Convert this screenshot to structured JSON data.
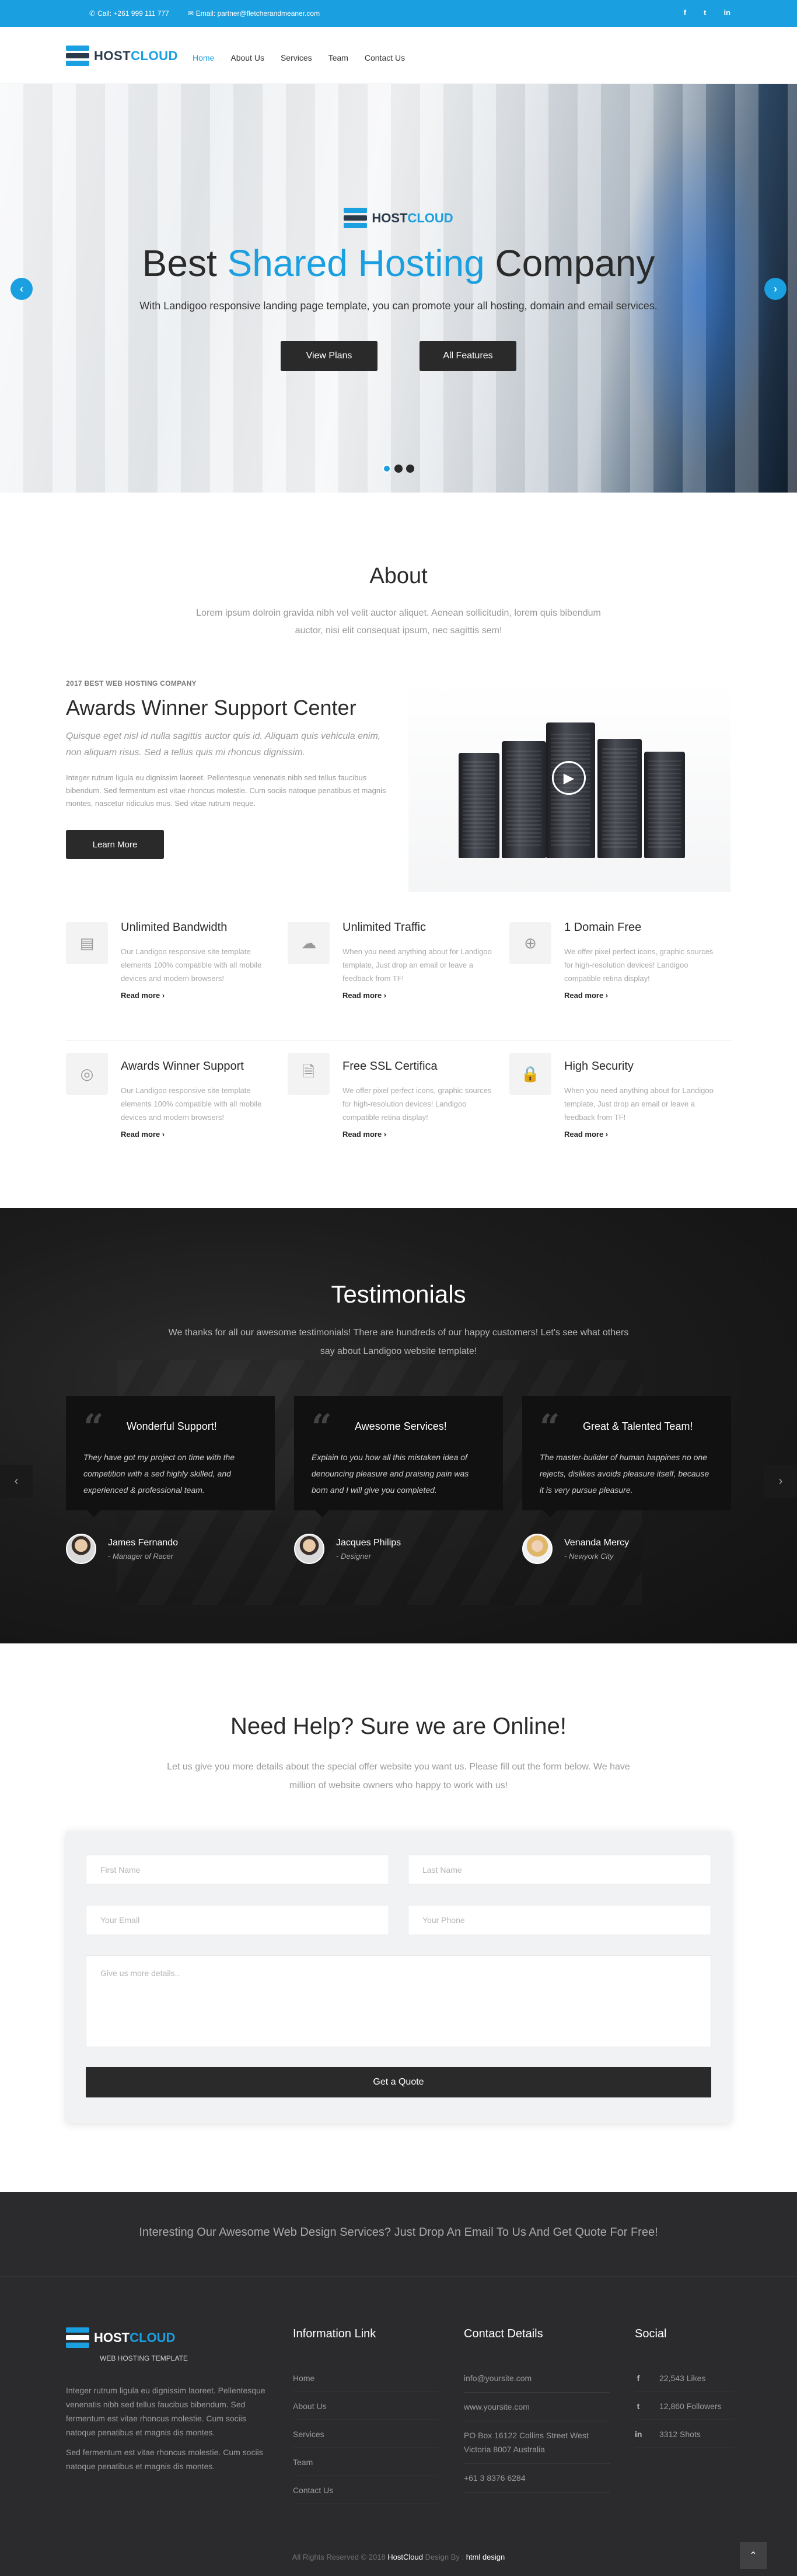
{
  "topbar": {
    "phone": "Call: +261 999 111 777",
    "email": "Email: partner@fletcherandmeaner.com",
    "social": [
      "f",
      "t",
      "in"
    ]
  },
  "brand": {
    "name_a": "HOST",
    "name_b": "CLOUD"
  },
  "nav": [
    "Home",
    "About Us",
    "Services",
    "Team",
    "Contact Us"
  ],
  "hero": {
    "title_a": "Best ",
    "title_hl": "Shared Hosting",
    "title_b": " Company",
    "subtitle": "With Landigoo responsive landing page template, you can promote your all hosting, domain and email services.",
    "btn_plans": "View Plans",
    "btn_features": "All Features",
    "prev": "‹",
    "next": "›"
  },
  "about": {
    "title": "About",
    "subtitle": "Lorem ipsum dolroin gravida nibh vel velit auctor aliquet. Aenean sollicitudin, lorem quis bibendum auctor, nisi elit consequat ipsum, nec sagittis sem!",
    "kicker": "2017 BEST WEB HOSTING COMPANY",
    "heading": "Awards Winner Support Center",
    "lead": "Quisque eget nisl id nulla sagittis auctor quis id. Aliquam quis vehicula enim, non aliquam risus. Sed a tellus quis mi rhoncus dignissim.",
    "body": "Integer rutrum ligula eu dignissim laoreet. Pellentesque venenatis nibh sed tellus faucibus bibendum. Sed fermentum est vitae rhoncus molestie. Cum sociis natoque penatibus et magnis montes, nascetur ridiculus mus. Sed vitae rutrum neque.",
    "btn": "Learn More"
  },
  "features": [
    {
      "icon": "film-icon",
      "glyph": "▤",
      "title": "Unlimited Bandwidth",
      "text": "Our Landigoo responsive site template elements 100% compatible with all mobile devices and modern browsers!",
      "link": "Read more ›"
    },
    {
      "icon": "cloud-icon",
      "glyph": "☁",
      "title": "Unlimited Traffic",
      "text": "When you need anything about for Landigoo template, Just drop an email or leave a feedback from TF!",
      "link": "Read more ›"
    },
    {
      "icon": "www-icon",
      "glyph": "⊕",
      "title": "1 Domain Free",
      "text": "We offer pixel perfect icons, graphic sources for high-resolution devices! Landigoo compatible retina display!",
      "link": "Read more ›"
    },
    {
      "icon": "wifi-icon",
      "glyph": "◎",
      "title": "Awards Winner Support",
      "text": "Our Landigoo responsive site template elements 100% compatible with all mobile devices and modern browsers!",
      "link": "Read more ›"
    },
    {
      "icon": "ssl-file-icon",
      "glyph": "🗎",
      "title": "Free SSL Certifica",
      "text": "We offer pixel perfect icons, graphic sources for high-resolution devices! Landigoo compatible retina display!",
      "link": "Read more ›"
    },
    {
      "icon": "lock-icon",
      "glyph": "🔒",
      "title": "High Security",
      "text": "When you need anything about for Landigoo template, Just drop an email or leave a feedback from TF!",
      "link": "Read more ›"
    }
  ],
  "testimonials": {
    "title": "Testimonials",
    "subtitle": "We thanks for all our awesome testimonials! There are hundreds of our happy customers! Let's see what others say about Landigoo website template!",
    "items": [
      {
        "heading": "Wonderful Support!",
        "text": "They have got my project on time with the competition with a sed highly skilled, and experienced & professional team.",
        "name": "James Fernando",
        "role": "- Manager of Racer"
      },
      {
        "heading": "Awesome Services!",
        "text": "Explain to you how all this mistaken idea of denouncing pleasure and praising pain was born and I will give you completed.",
        "name": "Jacques Philips",
        "role": "- Designer"
      },
      {
        "heading": "Great & Talented Team!",
        "text": "The master-builder of human happines no one rejects, dislikes avoids pleasure itself, because it is very pursue pleasure.",
        "name": "Venanda Mercy",
        "role": "- Newyork City"
      }
    ]
  },
  "contact": {
    "title": "Need Help? Sure we are Online!",
    "subtitle": "Let us give you more details about the special offer website you want us. Please fill out the form below. We have million of website owners who happy to work with us!",
    "first_name": "First Name",
    "last_name": "Last Name",
    "email": "Your Email",
    "phone": "Your Phone",
    "details": "Give us more details..",
    "submit": "Get a Quote"
  },
  "footer": {
    "cta": "Interesting Our Awesome Web Design Services? Just Drop An Email To Us And Get Quote For Free!",
    "tagline": "WEB HOSTING TEMPLATE",
    "about_1": "Integer rutrum ligula eu dignissim laoreet. Pellentesque venenatis nibh sed tellus faucibus bibendum. Sed fermentum est vitae rhoncus molestie. Cum sociis natoque penatibus et magnis dis montes.",
    "about_2": "Sed fermentum est vitae rhoncus molestie. Cum sociis natoque penatibus et magnis dis montes.",
    "info_title": "Information Link",
    "info_links": [
      "Home",
      "About Us",
      "Services",
      "Team",
      "Contact Us"
    ],
    "contact_title": "Contact Details",
    "contact_items": [
      "info@yoursite.com",
      "www.yoursite.com",
      "PO Box 16122 Collins Street West Victoria 8007 Australia",
      "+61 3 8376 6284"
    ],
    "social_title": "Social",
    "social_items": [
      {
        "icon": "f",
        "text": "22,543 Likes"
      },
      {
        "icon": "t",
        "text": "12,860 Followers"
      },
      {
        "icon": "in",
        "text": "3312 Shots"
      }
    ],
    "copy_a": "All Rights Reserved © 2018 ",
    "copy_brand": "HostCloud",
    "copy_b": " Design By : ",
    "copy_author": "html design",
    "totop": "⌃"
  }
}
